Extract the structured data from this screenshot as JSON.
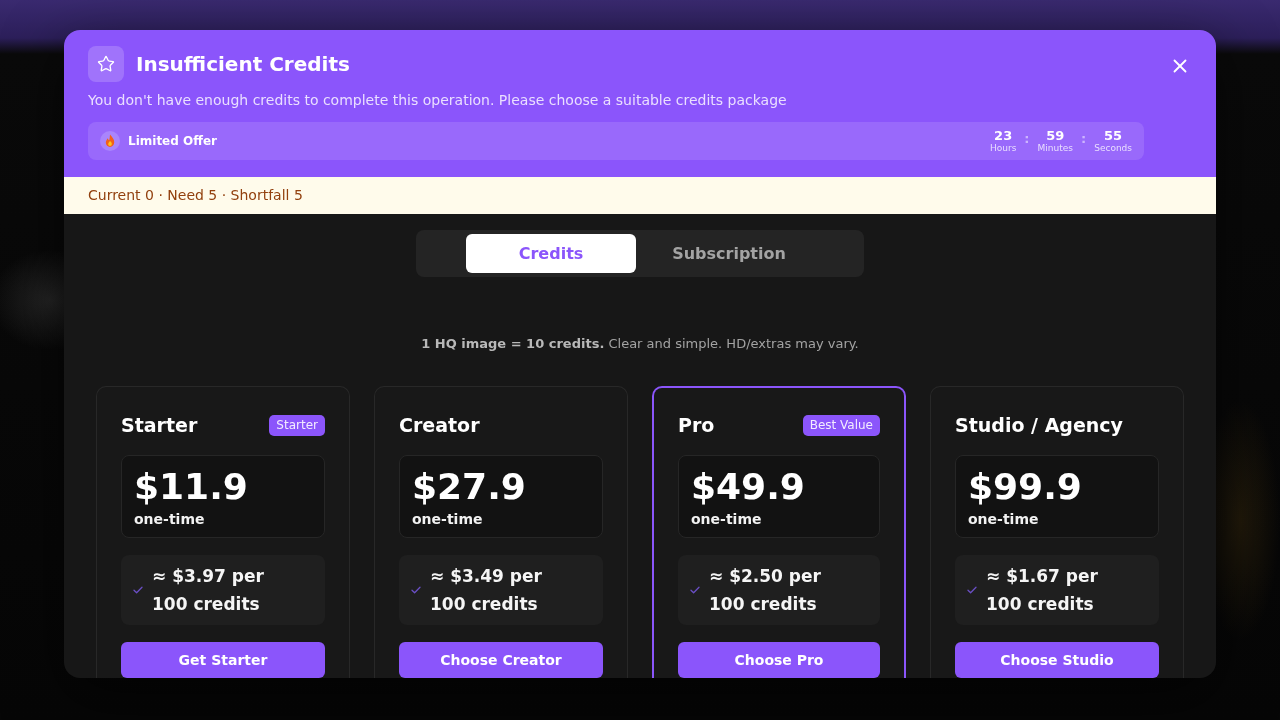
{
  "title": "Insufficient Credits",
  "message": "You don't have enough credits to complete this operation. Please choose a suitable credits package",
  "offer": {
    "label": "Limited Offer",
    "countdown": [
      {
        "kind": "unit",
        "value": "23",
        "unit": "Hours"
      },
      {
        "kind": "separator",
        "text": ":"
      },
      {
        "kind": "unit",
        "value": "59",
        "unit": "Minutes"
      },
      {
        "kind": "separator",
        "text": ":"
      },
      {
        "kind": "unit",
        "value": "55",
        "unit": "Seconds"
      }
    ]
  },
  "credit_status": "Current 0 · Need 5 · Shortfall 5",
  "tabs": [
    {
      "label": "Credits",
      "selected": true
    },
    {
      "label": "Subscription",
      "selected": false
    }
  ],
  "pricing_note": "**1 HQ image = 10 credits.** Clear and simple. HD/extras may vary.",
  "plans": [
    {
      "name": "Starter",
      "badge": "Starter",
      "price": "$11.9",
      "billing": "one-time",
      "rate": "≈ $3.97 per 100 credits",
      "button": "Get Starter",
      "highlighted": false
    },
    {
      "name": "Creator",
      "price": "$27.9",
      "billing": "one-time",
      "rate": "≈ $3.49 per 100 credits",
      "button": "Choose Creator",
      "highlighted": false
    },
    {
      "name": "Pro",
      "badge": "Best Value",
      "price": "$49.9",
      "billing": "one-time",
      "rate": "≈ $2.50 per 100 credits",
      "button": "Choose Pro",
      "highlighted": true
    },
    {
      "name": "Studio / Agency",
      "price": "$99.9",
      "billing": "one-time",
      "rate": "≈ $1.67 per 100 credits",
      "button": "Choose Studio",
      "highlighted": false
    }
  ]
}
